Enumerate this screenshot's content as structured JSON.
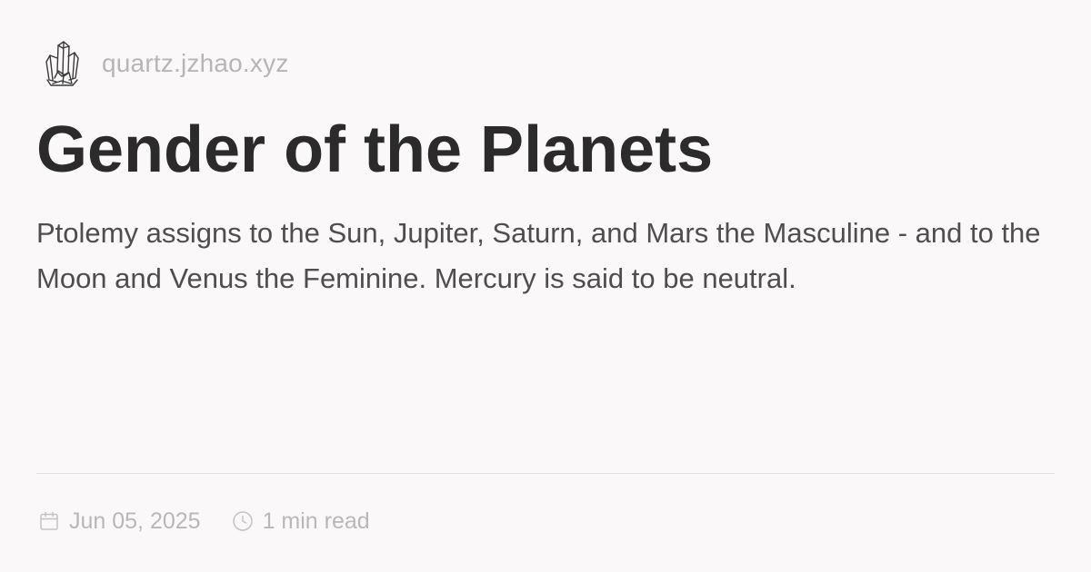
{
  "site": {
    "logo_icon": "crystal-icon",
    "name": "quartz.jzhao.xyz"
  },
  "article": {
    "title": "Gender of the Planets",
    "description": "Ptolemy assigns to the Sun, Jupiter, Saturn, and Mars the Masculine - and to the Moon and Venus the Feminine. Mercury is said to be neutral."
  },
  "meta": {
    "date_icon": "calendar-icon",
    "date": "Jun 05, 2025",
    "reading_time_icon": "clock-icon",
    "reading_time": "1 min read"
  },
  "colors": {
    "background": "#faf8f8",
    "title": "#2b2b2b",
    "body_text": "#4e4e4e",
    "muted": "#b9b7b7",
    "divider": "#e6e3e3"
  }
}
